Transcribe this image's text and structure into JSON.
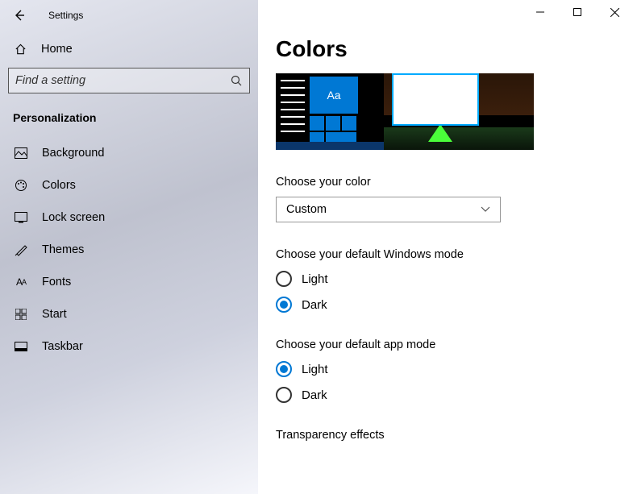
{
  "app_title": "Settings",
  "home_label": "Home",
  "search_placeholder": "Find a setting",
  "category": "Personalization",
  "nav": [
    {
      "label": "Background"
    },
    {
      "label": "Colors"
    },
    {
      "label": "Lock screen"
    },
    {
      "label": "Themes"
    },
    {
      "label": "Fonts"
    },
    {
      "label": "Start"
    },
    {
      "label": "Taskbar"
    }
  ],
  "page": {
    "title": "Colors",
    "preview_tile_text": "Aa",
    "choose_color_label": "Choose your color",
    "choose_color_value": "Custom",
    "windows_mode_label": "Choose your default Windows mode",
    "windows_mode_light": "Light",
    "windows_mode_dark": "Dark",
    "app_mode_label": "Choose your default app mode",
    "app_mode_light": "Light",
    "app_mode_dark": "Dark",
    "transparency_label": "Transparency effects"
  },
  "colors": {
    "accent": "#0078d4"
  }
}
